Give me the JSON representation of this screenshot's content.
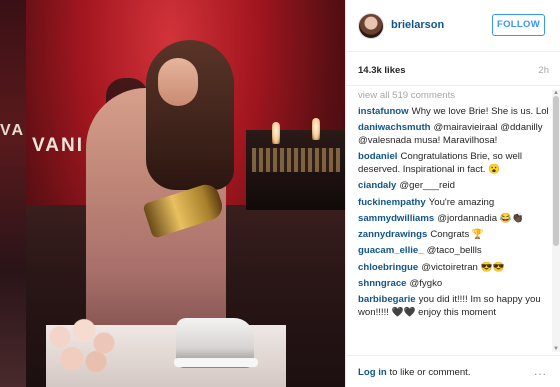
{
  "backdrop": {
    "sign_fragment": "VANI"
  },
  "photo": {
    "sign_text": "VANI"
  },
  "post": {
    "username": "brielarson",
    "follow_label": "FOLLOW",
    "likes": "14.3k likes",
    "age": "2h"
  },
  "comments": {
    "view_all": "view all 519 comments",
    "items": [
      {
        "user": "instafunow",
        "text": "Why we love Brie! She is us. Lol"
      },
      {
        "user": "daniwachsmuth",
        "text": "@mairavieiraal @ddanilly @valesnada musa! Maravilhosa!"
      },
      {
        "user": "bodaniel",
        "text": "Congratulations Brie, so well deserved. Inspirational in fact. 😮"
      },
      {
        "user": "ciandaly",
        "text": "@ger___reid"
      },
      {
        "user": "fuckinempathy",
        "text": "You're amazing"
      },
      {
        "user": "sammydwilliams",
        "text": "@jordannadia 😂👏🏿"
      },
      {
        "user": "zannydrawings",
        "text": "Congrats 🏆"
      },
      {
        "user": "guacam_ellie_",
        "text": "@taco_bellls"
      },
      {
        "user": "chloebringue",
        "text": "@victoiretran 😎😎"
      },
      {
        "user": "shnngrace",
        "text": "@fygko"
      },
      {
        "user": "barbibegarie",
        "text": "you did it!!!! Im so happy you won!!!!! 🖤🖤 enjoy this moment"
      }
    ]
  },
  "footer": {
    "login_link": "Log in",
    "login_rest": " to like or comment.",
    "more_label": "..."
  }
}
